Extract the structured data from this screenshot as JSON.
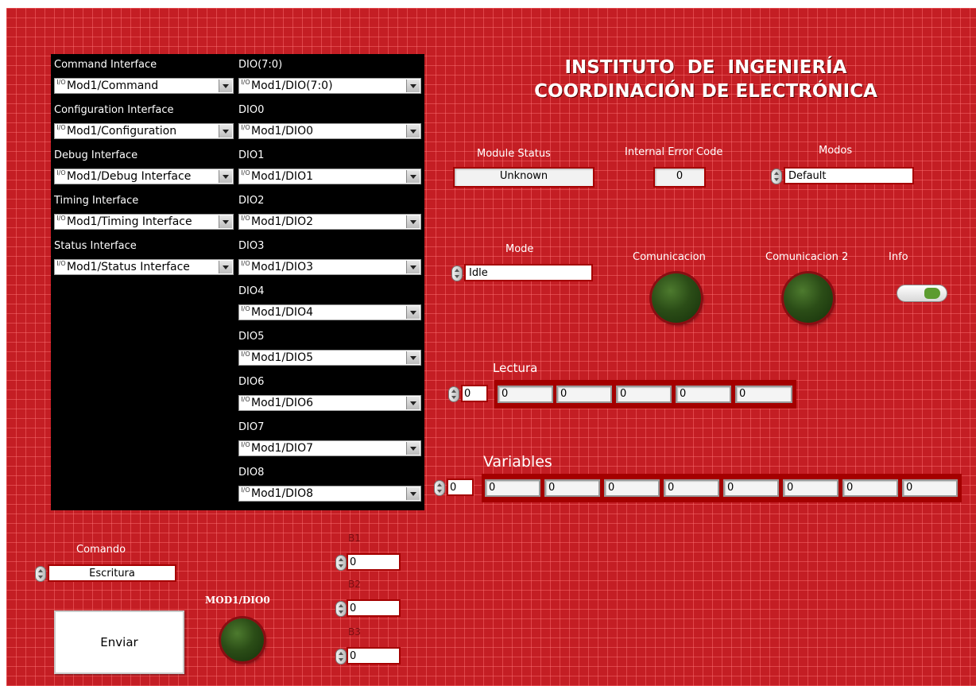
{
  "header": {
    "line1": "INSTITUTO  DE  INGENIERÍA",
    "line2": "COORDINACIÓN DE ELECTRÓNICA"
  },
  "interfaces": [
    {
      "label": "Command Interface",
      "value": "Mod1/Command"
    },
    {
      "label": "Configuration Interface",
      "value": "Mod1/Configuration"
    },
    {
      "label": "Debug Interface",
      "value": "Mod1/Debug Interface"
    },
    {
      "label": "Timing Interface",
      "value": "Mod1/Timing Interface"
    },
    {
      "label": "Status Interface",
      "value": "Mod1/Status Interface"
    }
  ],
  "dio": [
    {
      "label": "DIO(7:0)",
      "value": "Mod1/DIO(7:0)"
    },
    {
      "label": "DIO0",
      "value": "Mod1/DIO0"
    },
    {
      "label": "DIO1",
      "value": "Mod1/DIO1"
    },
    {
      "label": "DIO2",
      "value": "Mod1/DIO2"
    },
    {
      "label": "DIO3",
      "value": "Mod1/DIO3"
    },
    {
      "label": "DIO4",
      "value": "Mod1/DIO4"
    },
    {
      "label": "DIO5",
      "value": "Mod1/DIO5"
    },
    {
      "label": "DIO6",
      "value": "Mod1/DIO6"
    },
    {
      "label": "DIO7",
      "value": "Mod1/DIO7"
    },
    {
      "label": "DIO8",
      "value": "Mod1/DIO8"
    }
  ],
  "io_icon": "I/O",
  "status": {
    "module_status_label": "Module Status",
    "module_status_value": "Unknown",
    "error_code_label": "Internal Error Code",
    "error_code_value": "0",
    "modos_label": "Modos",
    "modos_value": "Default"
  },
  "mode": {
    "label": "Mode",
    "value": "Idle"
  },
  "leds": {
    "comunicacion_label": "Comunicacion",
    "comunicacion2_label": "Comunicacion 2",
    "info_label": "Info",
    "mod1_dio0_label": "MOD1/DIO0",
    "color": "#2b4d17"
  },
  "lectura": {
    "label": "Lectura",
    "index": "0",
    "values": [
      "0",
      "0",
      "0",
      "0",
      "0"
    ]
  },
  "variables": {
    "label": "Variables",
    "index": "0",
    "values": [
      "0",
      "0",
      "0",
      "0",
      "0",
      "0",
      "0",
      "0"
    ]
  },
  "comando": {
    "label": "Comando",
    "value": "Escritura"
  },
  "enviar_label": "Enviar",
  "bytes": [
    {
      "label": "B1",
      "value": "0"
    },
    {
      "label": "B2",
      "value": "0"
    },
    {
      "label": "B3",
      "value": "0"
    }
  ],
  "colors": {
    "panel": "#c41e24",
    "cluster": "#000000",
    "led": "#2b4d17"
  }
}
